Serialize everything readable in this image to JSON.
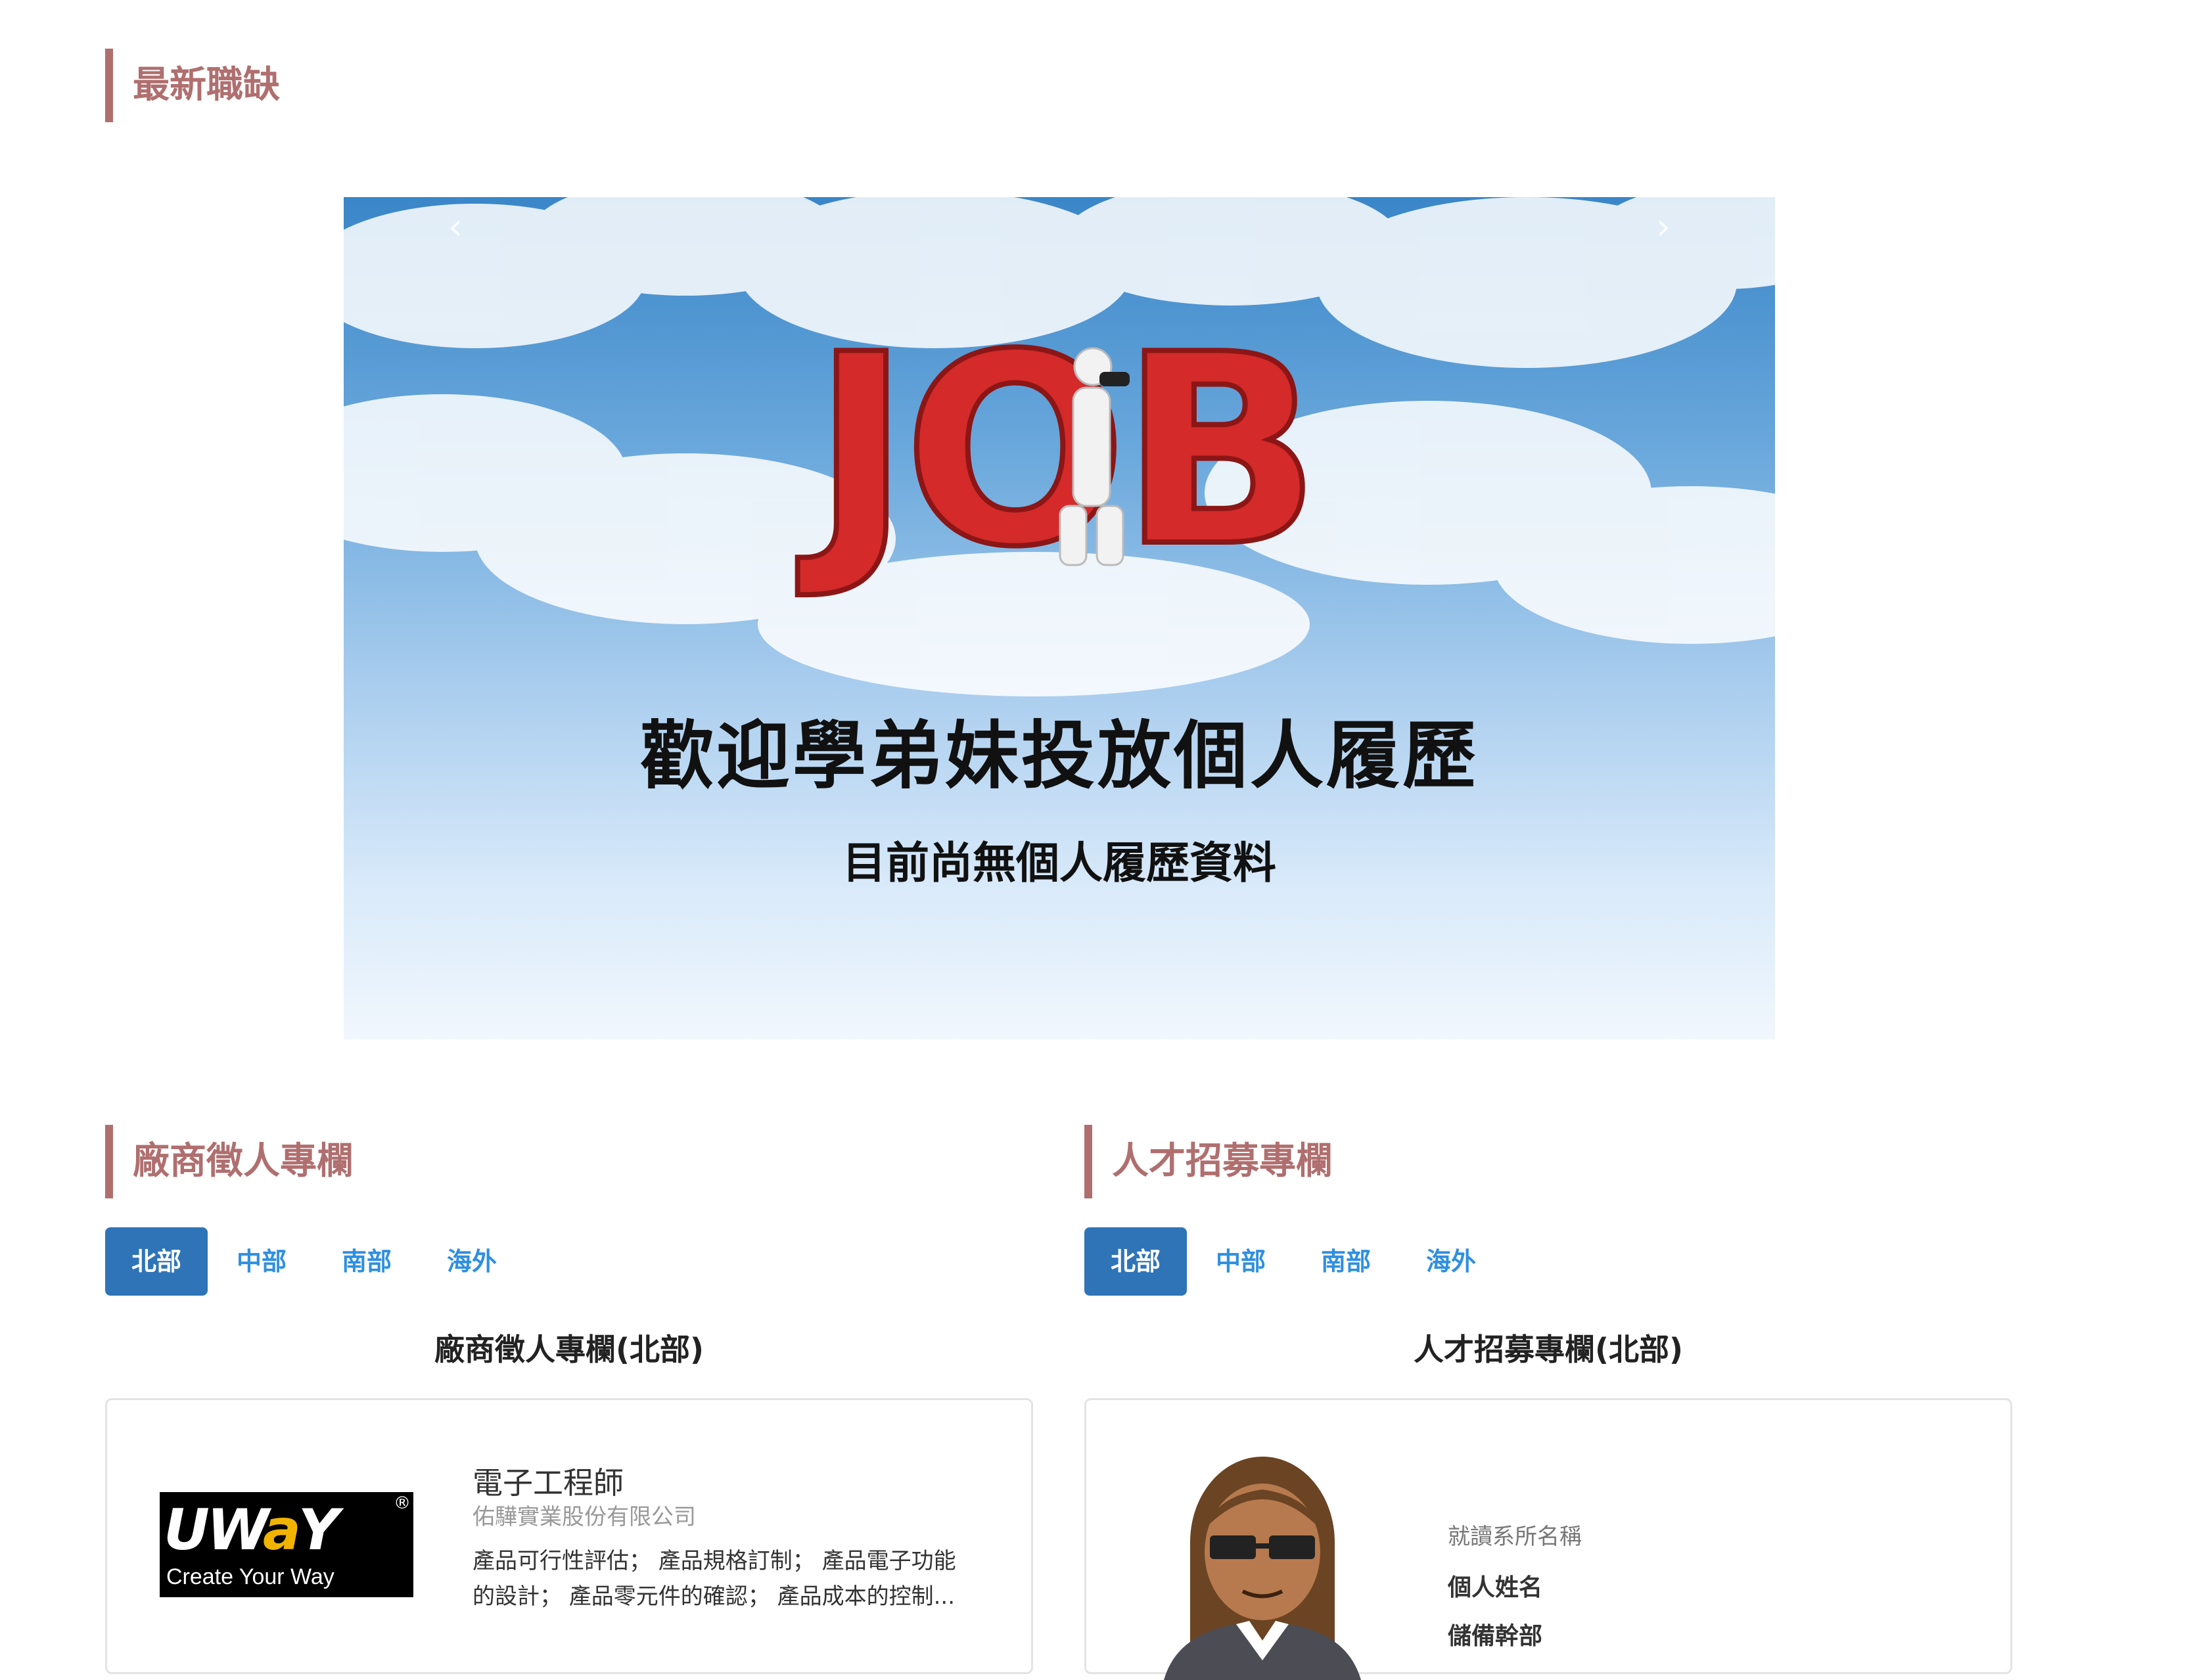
{
  "latest_jobs": {
    "title": "最新職缺"
  },
  "banner": {
    "logo_text": "JOB",
    "headline": "歡迎學弟妹投放個人履歷",
    "subtext": "目前尚無個人履歷資料",
    "prev_icon": "‹",
    "next_icon": "›"
  },
  "employer_section": {
    "title": "廠商徵人專欄",
    "tabs": [
      "北部",
      "中部",
      "南部",
      "海外"
    ],
    "active_tab": "北部",
    "heading": "廠商徵人專欄(北部)",
    "card": {
      "logo": {
        "brand": "uway",
        "tagline": "Create Your Way",
        "reg": "®"
      },
      "job_title": "電子工程師",
      "company": "佑驊實業股份有限公司",
      "description": "產品可行性評估； 產品規格訂制； 產品電子功能的設計； 產品零元件的確認； 產品成本的控制..."
    }
  },
  "talent_section": {
    "title": "人才招募專欄",
    "tabs": [
      "北部",
      "中部",
      "南部",
      "海外"
    ],
    "active_tab": "北部",
    "heading": "人才招募專欄(北部)",
    "card": {
      "avatar_icon": "person-avatar-icon",
      "department": "就讀系所名稱",
      "name": "個人姓名",
      "role": "儲備幹部"
    }
  },
  "colors": {
    "accent": "#b06f6f",
    "tab_active": "#2f74b7",
    "tab_link": "#2f8fe0",
    "job_red": "#d42a2a"
  }
}
